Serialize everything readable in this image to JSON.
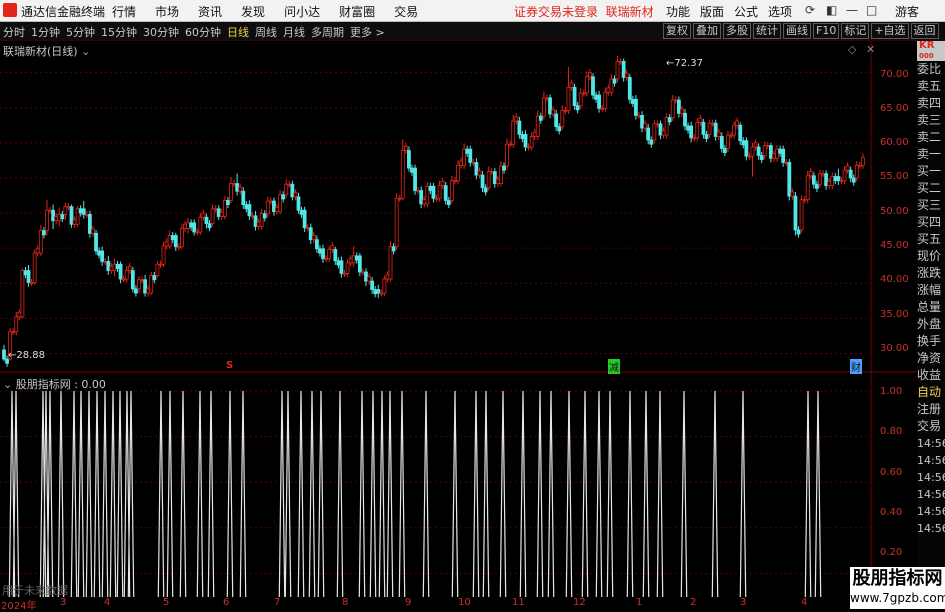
{
  "titlebar": {
    "app_title": "通达信金融终端",
    "menu": [
      "行情",
      "市场",
      "资讯",
      "发现",
      "问小达",
      "财富圈",
      "交易"
    ],
    "warning": "证券交易未登录",
    "stock_name": "联瑞新材",
    "right_menu": [
      "功能",
      "版面",
      "公式",
      "选项"
    ],
    "guest": "游客"
  },
  "toolbar": {
    "periods": [
      "分时",
      "1分钟",
      "5分钟",
      "15分钟",
      "30分钟",
      "60分钟",
      "日线",
      "周线",
      "月线",
      "多周期",
      "更多 >"
    ],
    "active_period": "日线",
    "tools": [
      "复权",
      "叠加",
      "多股",
      "统计",
      "画线",
      "F10",
      "标记",
      "+自选",
      "返回"
    ]
  },
  "main_chart": {
    "label": "联瑞新材(日线)",
    "high_annotation": "72.37",
    "low_annotation": "28.88",
    "y_ticks": [
      "70.00",
      "65.00",
      "60.00",
      "55.00",
      "50.00",
      "45.00",
      "40.00",
      "35.00",
      "30.00"
    ],
    "markers": [
      {
        "text": "S",
        "color": "#e0251b"
      },
      {
        "text": "减",
        "color": "#28c828"
      },
      {
        "text": "财",
        "color": "#4aa0ff"
      }
    ]
  },
  "sub_chart": {
    "label": "股朋指标网 : 0.00",
    "y_ticks": [
      "1.00",
      "0.80",
      "0.60",
      "0.40",
      "0.20"
    ],
    "bottom_text": "用于未来数据"
  },
  "date_axis": [
    "2024年",
    "3",
    "4",
    "5",
    "6",
    "7",
    "8",
    "9",
    "10",
    "11",
    "12",
    "1",
    "2",
    "3",
    "4"
  ],
  "right_panel": {
    "top": "KR",
    "top2": "000",
    "items": [
      "委比",
      "卖五",
      "卖四",
      "卖三",
      "卖二",
      "卖一",
      "买一",
      "买二",
      "买三",
      "买四",
      "买五",
      "现价",
      "涨跌",
      "涨幅",
      "总量",
      "外盘",
      "换手",
      "净资",
      "收益"
    ],
    "items2": [
      "自动",
      "注册",
      "交易"
    ],
    "times": [
      "14:56",
      "14:56",
      "14:56",
      "14:56",
      "14:56",
      "14:56",
      "14:56"
    ]
  },
  "watermark": {
    "title": "股朋指标网",
    "url": "www.7gpzb.com"
  },
  "chart_data": {
    "type": "candlestick",
    "ylim": [
      27.5,
      74.5
    ],
    "seed": [
      [
        30.5,
        29.2,
        31.2,
        28.9
      ],
      [
        29.2,
        33.1,
        33.6,
        29.0
      ],
      [
        33.1,
        35.2,
        35.9,
        32.6
      ],
      [
        35.2,
        41.8,
        42.1,
        35.0
      ],
      [
        41.8,
        40.1,
        42.6,
        39.5
      ],
      [
        40.1,
        44.3,
        44.8,
        39.8
      ],
      [
        44.3,
        47.5,
        48.3,
        43.9
      ],
      [
        47.5,
        50.4,
        51.9,
        46.8
      ],
      [
        50.4,
        48.9,
        51.2,
        47.7
      ],
      [
        48.9,
        49.8,
        50.8,
        48.1
      ],
      [
        49.8,
        50.9,
        51.5,
        49.0
      ],
      [
        50.9,
        48.4,
        51.2,
        47.9
      ],
      [
        48.4,
        50.6,
        51.0,
        48.0
      ],
      [
        50.6,
        49.8,
        51.7,
        49.2
      ],
      [
        49.8,
        47.1,
        50.3,
        46.5
      ],
      [
        47.1,
        44.6,
        47.6,
        44.1
      ],
      [
        44.6,
        43.1,
        45.2,
        42.5
      ],
      [
        43.1,
        41.8,
        43.9,
        41.2
      ],
      [
        41.8,
        42.7,
        43.5,
        41.0
      ],
      [
        42.7,
        40.6,
        43.1,
        40.0
      ],
      [
        40.6,
        41.8,
        42.5,
        40.1
      ],
      [
        41.8,
        39.2,
        42.3,
        38.7
      ],
      [
        39.2,
        40.5,
        41.0,
        38.6
      ],
      [
        40.5,
        38.6,
        41.2,
        38.1
      ],
      [
        38.6,
        41.1,
        41.6,
        38.3
      ],
      [
        41.1,
        42.7,
        43.2,
        40.8
      ],
      [
        42.7,
        45.3,
        45.9,
        42.3
      ],
      [
        45.3,
        46.8,
        47.5,
        44.9
      ],
      [
        46.8,
        45.2,
        47.2,
        44.6
      ],
      [
        45.2,
        47.8,
        48.5,
        44.9
      ],
      [
        47.8,
        48.6,
        49.3,
        47.1
      ],
      [
        48.6,
        47.3,
        49.1,
        46.8
      ],
      [
        47.3,
        49.4,
        50.0,
        46.9
      ],
      [
        49.4,
        48.5,
        49.9,
        47.8
      ],
      [
        48.5,
        50.6,
        51.2,
        48.1
      ],
      [
        50.6,
        49.5,
        51.1,
        49.0
      ],
      [
        49.5,
        51.8,
        52.4,
        49.1
      ],
      [
        51.8,
        54.2,
        55.1,
        51.4
      ],
      [
        54.2,
        53.1,
        55.6,
        52.5
      ],
      [
        53.1,
        51.2,
        53.7,
        50.6
      ],
      [
        51.2,
        49.6,
        51.8,
        49.0
      ],
      [
        49.6,
        48.1,
        50.3,
        47.5
      ],
      [
        48.1,
        49.9,
        50.6,
        47.6
      ],
      [
        49.9,
        51.7,
        52.3,
        49.4
      ],
      [
        51.7,
        50.2,
        52.2,
        49.6
      ],
      [
        50.2,
        52.6,
        53.3,
        49.8
      ],
      [
        52.6,
        54.1,
        54.8,
        52.1
      ],
      [
        54.1,
        52.3,
        54.6,
        51.8
      ],
      [
        52.3,
        50.4,
        52.9,
        49.9
      ],
      [
        50.4,
        47.9,
        50.9,
        47.3
      ],
      [
        47.9,
        46.2,
        48.5,
        45.6
      ],
      [
        46.2,
        44.9,
        46.8,
        44.3
      ],
      [
        44.9,
        43.5,
        45.5,
        42.9
      ],
      [
        43.5,
        44.8,
        45.3,
        43.0
      ],
      [
        44.8,
        43.2,
        45.2,
        42.6
      ],
      [
        43.2,
        41.4,
        43.8,
        40.8
      ],
      [
        41.4,
        42.9,
        43.4,
        40.9
      ],
      [
        42.9,
        43.9,
        45.3,
        42.4
      ],
      [
        43.9,
        41.6,
        44.3,
        41.0
      ],
      [
        41.6,
        40.3,
        42.1,
        39.6
      ],
      [
        40.3,
        39.1,
        40.9,
        38.5
      ],
      [
        39.1,
        38.6,
        39.8,
        37.9
      ],
      [
        38.6,
        40.6,
        41.1,
        38.2
      ],
      [
        40.6,
        45.2,
        46.0,
        40.3
      ],
      [
        45.2,
        52.1,
        52.8,
        44.8
      ],
      [
        52.1,
        58.9,
        60.5,
        51.8
      ],
      [
        58.9,
        56.4,
        59.5,
        55.9
      ],
      [
        56.4,
        53.2,
        56.9,
        52.6
      ],
      [
        53.2,
        51.3,
        53.8,
        50.7
      ],
      [
        51.3,
        53.8,
        54.4,
        50.8
      ],
      [
        53.8,
        52.1,
        54.3,
        51.5
      ],
      [
        52.1,
        53.9,
        54.6,
        51.6
      ],
      [
        53.9,
        51.8,
        54.4,
        51.2
      ],
      [
        51.8,
        54.6,
        55.3,
        51.4
      ],
      [
        54.6,
        56.8,
        57.5,
        54.1
      ],
      [
        56.8,
        59.1,
        59.9,
        56.3
      ],
      [
        59.1,
        57.2,
        59.6,
        56.6
      ],
      [
        57.2,
        55.4,
        57.8,
        54.8
      ],
      [
        55.4,
        53.6,
        56.0,
        53.0
      ],
      [
        53.6,
        55.9,
        56.6,
        53.2
      ],
      [
        55.9,
        54.2,
        56.4,
        53.6
      ],
      [
        54.2,
        56.7,
        57.4,
        53.8
      ],
      [
        56.7,
        59.8,
        60.6,
        56.2
      ],
      [
        59.8,
        63.1,
        64.0,
        59.3
      ],
      [
        63.1,
        61.2,
        63.7,
        60.6
      ],
      [
        61.2,
        59.4,
        61.8,
        58.8
      ],
      [
        59.4,
        60.9,
        61.5,
        58.9
      ],
      [
        60.9,
        63.8,
        64.6,
        60.4
      ],
      [
        63.8,
        66.4,
        67.3,
        63.3
      ],
      [
        66.4,
        64.1,
        66.9,
        63.5
      ],
      [
        64.1,
        62.3,
        64.7,
        61.7
      ],
      [
        62.3,
        64.6,
        65.3,
        61.9
      ],
      [
        64.6,
        67.9,
        70.8,
        64.1
      ],
      [
        67.9,
        65.3,
        68.4,
        64.7
      ],
      [
        65.3,
        67.1,
        67.8,
        64.8
      ],
      [
        67.1,
        69.4,
        70.2,
        66.6
      ],
      [
        69.4,
        66.8,
        69.9,
        66.2
      ],
      [
        66.8,
        64.9,
        67.4,
        64.3
      ],
      [
        64.9,
        67.2,
        67.9,
        64.4
      ],
      [
        67.2,
        69.1,
        69.8,
        66.7
      ],
      [
        69.1,
        71.6,
        72.4,
        68.6
      ],
      [
        71.6,
        69.3,
        72.0,
        68.7
      ],
      [
        69.3,
        66.2,
        69.8,
        65.6
      ],
      [
        66.2,
        63.9,
        66.8,
        63.3
      ],
      [
        63.9,
        62.1,
        64.5,
        61.5
      ],
      [
        62.1,
        60.4,
        62.7,
        59.8
      ],
      [
        60.4,
        62.7,
        63.3,
        59.9
      ],
      [
        62.7,
        61.1,
        63.2,
        60.5
      ],
      [
        61.1,
        63.6,
        64.2,
        60.6
      ],
      [
        63.6,
        66.1,
        66.8,
        63.1
      ],
      [
        66.1,
        64.2,
        66.6,
        63.6
      ],
      [
        64.2,
        62.4,
        64.8,
        61.8
      ],
      [
        62.4,
        60.7,
        63.0,
        60.1
      ],
      [
        60.7,
        62.9,
        63.5,
        60.2
      ],
      [
        62.9,
        61.2,
        63.4,
        60.6
      ],
      [
        61.2,
        62.8,
        63.3,
        60.7
      ],
      [
        62.8,
        60.9,
        63.3,
        60.3
      ],
      [
        60.9,
        59.2,
        61.5,
        58.6
      ],
      [
        59.2,
        61.1,
        61.7,
        58.7
      ],
      [
        61.1,
        62.5,
        63.0,
        60.6
      ],
      [
        62.5,
        60.3,
        62.9,
        59.7
      ],
      [
        60.3,
        58.1,
        60.8,
        57.5
      ],
      [
        58.1,
        59.4,
        60.0,
        55.2
      ],
      [
        59.4,
        58.2,
        59.9,
        57.6
      ],
      [
        58.2,
        59.6,
        60.2,
        57.7
      ],
      [
        59.6,
        57.8,
        60.0,
        57.2
      ],
      [
        57.8,
        59.1,
        59.7,
        57.3
      ],
      [
        59.1,
        57.2,
        59.6,
        56.6
      ],
      [
        57.2,
        52.4,
        57.7,
        51.8
      ],
      [
        52.4,
        47.6,
        53.0,
        46.8
      ],
      [
        47.6,
        51.9,
        52.5,
        47.2
      ],
      [
        51.9,
        55.3,
        56.0,
        51.4
      ],
      [
        55.3,
        54.1,
        55.8,
        53.5
      ],
      [
        54.1,
        55.6,
        56.2,
        53.6
      ],
      [
        55.6,
        53.9,
        56.1,
        53.3
      ],
      [
        53.9,
        55.2,
        55.8,
        53.4
      ],
      [
        55.2,
        54.6,
        56.3,
        54.0
      ],
      [
        54.6,
        56.1,
        56.7,
        54.1
      ],
      [
        56.1,
        55.0,
        56.6,
        54.4
      ],
      [
        55.0,
        56.8,
        57.4,
        54.5
      ],
      [
        56.8,
        57.9,
        58.5,
        56.3
      ]
    ],
    "signal_positions": [
      12,
      16,
      43,
      46,
      50,
      61,
      74,
      81,
      89,
      97,
      105,
      113,
      120,
      127,
      131,
      161,
      170,
      183,
      200,
      211,
      230,
      243,
      282,
      288,
      301,
      312,
      321,
      340,
      362,
      373,
      382,
      390,
      402,
      426,
      455,
      476,
      486,
      503,
      523,
      540,
      551,
      569,
      585,
      599,
      610,
      630,
      646,
      660,
      684,
      715,
      743,
      808,
      818
    ]
  }
}
